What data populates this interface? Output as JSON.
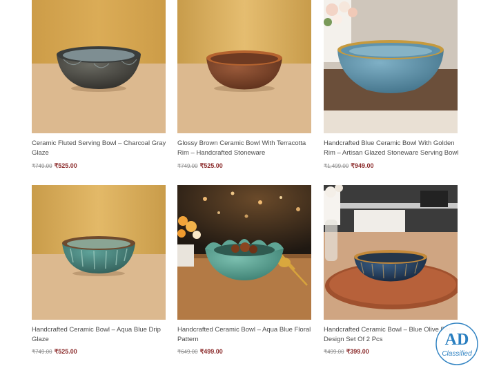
{
  "products": [
    {
      "title": "Ceramic Fluted Serving Bowl – Charcoal Gray Glaze",
      "old_price": "₹749.00",
      "price": "₹525.00"
    },
    {
      "title": "Glossy Brown Ceramic Bowl With Terracotta Rim – Handcrafted Stoneware",
      "old_price": "₹749.00",
      "price": "₹525.00"
    },
    {
      "title": "Handcrafted Blue Ceramic Bowl With Golden Rim – Artisan Glazed Stoneware Serving Bowl",
      "old_price": "₹1,499.00",
      "price": "₹949.00"
    },
    {
      "title": "Handcrafted Ceramic Bowl – Aqua Blue Drip Glaze",
      "old_price": "₹749.00",
      "price": "₹525.00"
    },
    {
      "title": "Handcrafted Ceramic Bowl – Aqua Blue Floral Pattern",
      "old_price": "₹649.00",
      "price": "₹499.00"
    },
    {
      "title": "Handcrafted Ceramic Bowl – Blue Olive Petal Design Set Of 2 Pcs",
      "old_price": "₹499.00",
      "price": "₹399.00"
    }
  ],
  "badge": {
    "line1": "AD",
    "line2": "Classified"
  },
  "colors": {
    "sale_price": "#8b2b2b",
    "old_price": "#8c8c8c",
    "title_text": "#4a4a4a",
    "badge_blue": "#2a7fc0"
  }
}
